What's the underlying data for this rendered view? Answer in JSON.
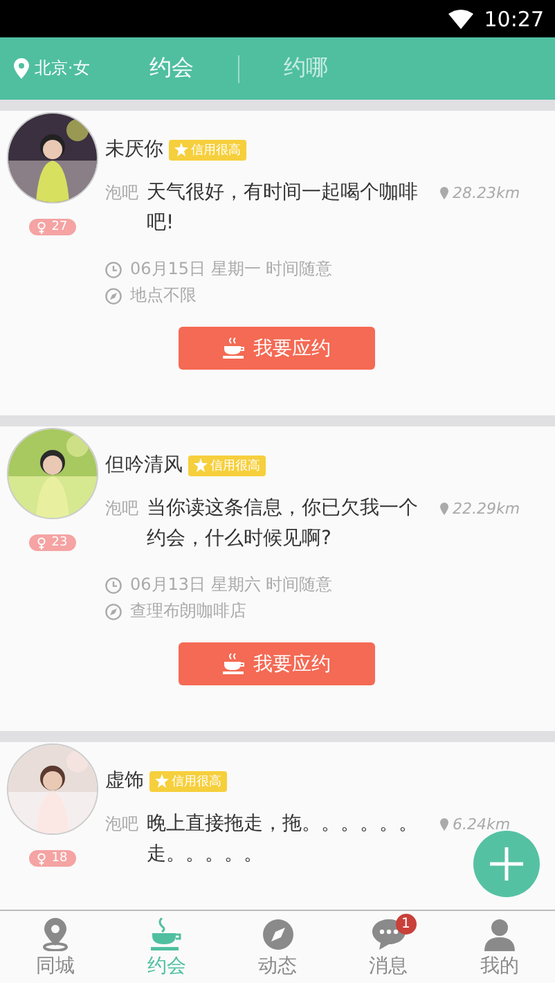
{
  "status_bar": {
    "time": "10:27"
  },
  "header": {
    "location": "北京·女",
    "tabs": [
      {
        "label": "约会",
        "selected": true
      },
      {
        "label": "约哪",
        "selected": false
      }
    ]
  },
  "cards": [
    {
      "name": "未厌你",
      "badge": "信用很高",
      "category": "泡吧",
      "message": "天气很好，有时间一起喝个咖啡吧!",
      "distance": "28.23km",
      "age": "27",
      "date": "06月15日 星期一 时间随意",
      "place": "地点不限",
      "button": "我要应约"
    },
    {
      "name": "但吟清风",
      "badge": "信用很高",
      "category": "泡吧",
      "message": "当你读这条信息，你已欠我一个约会，什么时候见啊?",
      "distance": "22.29km",
      "age": "23",
      "date": "06月13日 星期六 时间随意",
      "place": "查理布朗咖啡店",
      "button": "我要应约"
    },
    {
      "name": "虚饰",
      "badge": "信用很高",
      "category": "泡吧",
      "message": "晚上直接拖走，拖。。。。。。走。。。。。",
      "distance": "6.24km",
      "age": "18"
    }
  ],
  "tab_bar": [
    {
      "label": "同城",
      "selected": false
    },
    {
      "label": "约会",
      "selected": true
    },
    {
      "label": "动态",
      "selected": false
    },
    {
      "label": "消息",
      "selected": false,
      "badge": "1"
    },
    {
      "label": "我的",
      "selected": false
    }
  ]
}
